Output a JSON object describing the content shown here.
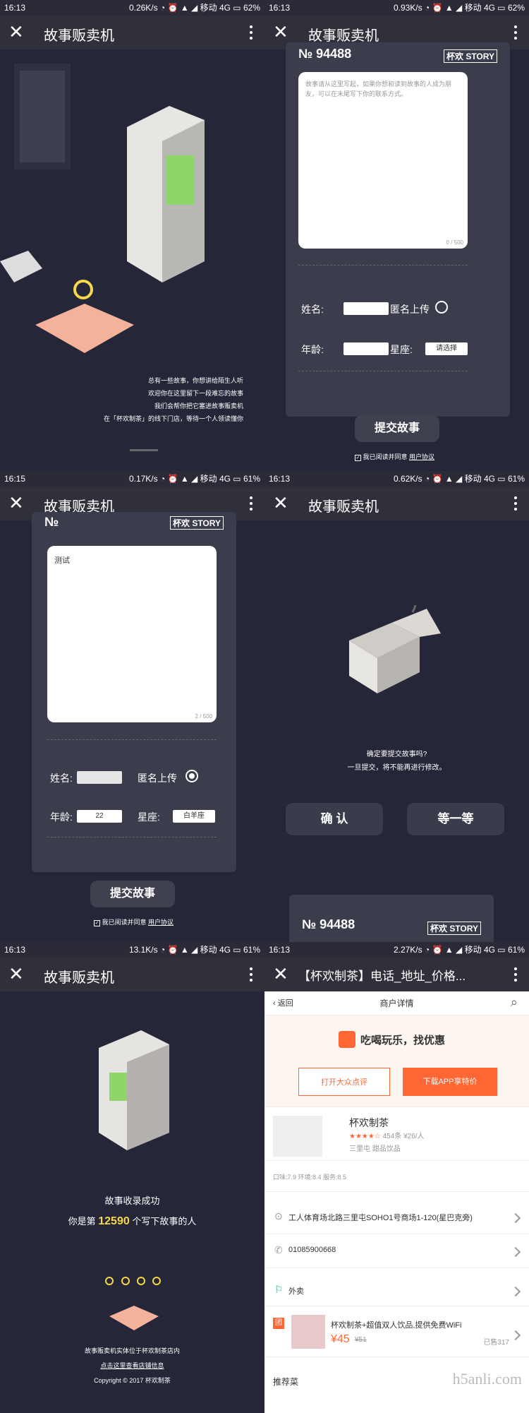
{
  "panels": [
    {
      "time": "16:13",
      "net": "0.26K/s",
      "carrier": "移动 4G",
      "battery": "62%",
      "title": "故事贩卖机",
      "intro": [
        "总有一些故事，你想讲给陌生人听",
        "欢迎你在这里留下一段难忘的故事",
        "我们会帮你把它塞进故事贩卖机",
        "在「杯欢制茶」的线下门店，等待一个人领读懂你"
      ]
    },
    {
      "time": "16:13",
      "net": "0.93K/s",
      "carrier": "移动 4G",
      "battery": "62%",
      "title": "故事贩卖机",
      "ticket_no": "№  94488",
      "brand": "杯欢 STORY",
      "placeholder": "故事请从这里写起，如果你想和读到故事的人成为朋友，可以在末尾写下你的联系方式。",
      "counter": "0 / 500",
      "name_label": "姓名:",
      "anon_label": "匿名上传",
      "age_label": "年龄:",
      "zodiac_label": "星座:",
      "zodiac_value": "请选择",
      "submit": "提交故事",
      "agree": "我已阅读并同意",
      "agree_link": "用户协议"
    },
    {
      "time": "16:15",
      "net": "0.17K/s",
      "carrier": "移动 4G",
      "battery": "61%",
      "title": "故事贩卖机",
      "ticket_no": "№",
      "brand": "杯欢 STORY",
      "text": "测试",
      "counter": "2 / 500",
      "name_label": "姓名:",
      "anon_label": "匿名上传",
      "age_label": "年龄:",
      "age_value": "22",
      "zodiac_label": "星座:",
      "zodiac_value": "白羊座",
      "submit": "提交故事",
      "agree": "我已阅读并同意",
      "agree_link": "用户协议"
    },
    {
      "time": "16:13",
      "net": "0.62K/s",
      "carrier": "移动 4G",
      "battery": "61%",
      "title": "故事贩卖机",
      "confirm_text": [
        "确定要提交故事吗?",
        "一旦提交，将不能再进行修改。"
      ],
      "confirm": "确 认",
      "wait": "等一等",
      "ticket_no": "№  94488",
      "brand": "杯欢 STORY"
    },
    {
      "time": "16:13",
      "net": "13.1K/s",
      "carrier": "移动 4G",
      "battery": "61%",
      "title": "故事贩卖机",
      "success": "故事收录成功",
      "count_pre": "你是第",
      "count": "12590",
      "count_post": "个写下故事的人",
      "footer": [
        "故事贩卖机实体位于杯欢制茶店内",
        "点击这里查看店铺信息",
        "Copyright © 2017 杯欢制茶"
      ]
    },
    {
      "time": "16:13",
      "net": "2.27K/s",
      "carrier": "移动 4G",
      "battery": "61%",
      "title": "【杯欢制茶】电话_地址_价格...",
      "back": "返回",
      "header": "商户详情",
      "slogan": "吃喝玩乐，找优惠",
      "btn_open": "打开大众点评",
      "btn_download": "下载APP享特价",
      "shop_name": "杯欢制茶",
      "reviews": "454条",
      "price": "¥26/人",
      "area": "三里屯 甜品饮品",
      "scores": "口味:7.9  环境:8.4  服务:8.5",
      "address": "工人体育场北路三里屯SOHO1号商场1-120(星巴克旁)",
      "phone": "01085900668",
      "takeout": "外卖",
      "deal_title": "杯欢制茶+超值双人饮品,提供免费WiFi",
      "deal_price": "¥45",
      "deal_orig": "¥51",
      "deal_sold": "已售317",
      "recommend": "推荐菜",
      "watermark": "h5anli.com"
    }
  ]
}
